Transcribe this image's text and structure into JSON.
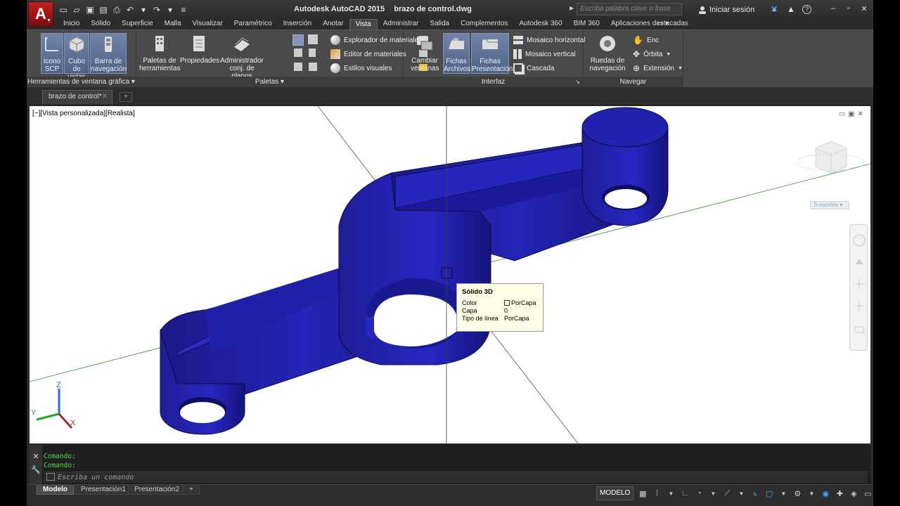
{
  "titlebar": {
    "app_button": "A",
    "app_name": "Autodesk AutoCAD 2015",
    "filename": "brazo de control.dwg",
    "search_placeholder": "Escriba palabra clave o frase",
    "sign_in": "Iniciar sesión"
  },
  "tabs": [
    "Inicio",
    "Sólido",
    "Superficie",
    "Malla",
    "Visualizar",
    "Paramétrico",
    "Inserción",
    "Anotar",
    "Vista",
    "Administrar",
    "Salida",
    "Complementos",
    "Autodesk 360",
    "BIM 360",
    "Aplicaciones destacadas"
  ],
  "active_tab": "Vista",
  "ribbon": {
    "panel1": {
      "title": "Herramientas de ventana gráfica",
      "buttons": [
        {
          "label1": "Icono",
          "label2": "SCP"
        },
        {
          "label1": "Cubo de",
          "label2": "vistas"
        },
        {
          "label1": "Barra de",
          "label2": "navegación"
        }
      ]
    },
    "panel2": {
      "title": "Paletas",
      "buttons": [
        {
          "label1": "Paletas de",
          "label2": "herramientas"
        },
        {
          "label1": "Propiedades",
          "label2": ""
        },
        {
          "label1": "Administrador",
          "label2": "conj. de planos"
        }
      ],
      "small": [
        "Explorador de materiales",
        "Editor de materiales",
        "Estilos visuales"
      ]
    },
    "panel3": {
      "title": "Interfaz",
      "buttons": [
        {
          "label1": "Cambiar",
          "label2": "ventanas"
        },
        {
          "label1": "Fichas",
          "label2": "Archivos"
        },
        {
          "label1": "Fichas",
          "label2": "Presentación"
        }
      ],
      "small": [
        "Mosaico horizontal",
        "Mosaico vertical",
        "Cascada"
      ]
    },
    "panel4": {
      "title": "Navegar",
      "buttons": [
        {
          "label1": "Ruedas de",
          "label2": "navegación"
        }
      ],
      "small": [
        "Enc",
        "Órbita",
        "Extensión"
      ]
    }
  },
  "document": {
    "tab_label": "brazo de control*"
  },
  "viewport": {
    "label": "[−][Vista personalizada][Realista]",
    "navcube_label": "S-nombre",
    "model_color": "#1d1f9c",
    "tooltip": {
      "title": "Sólido 3D",
      "rows": [
        {
          "key": "Color",
          "value": "PorCapa"
        },
        {
          "key": "Capa",
          "value": "0"
        },
        {
          "key": "Tipo de línea",
          "value": "PorCapa"
        }
      ]
    }
  },
  "command": {
    "history": [
      "Comando:",
      "Comando:"
    ],
    "placeholder": "Escriba un comando"
  },
  "layout_tabs": [
    "Modelo",
    "Presentación1",
    "Presentación2"
  ],
  "status": {
    "modelo": "MODELO"
  }
}
